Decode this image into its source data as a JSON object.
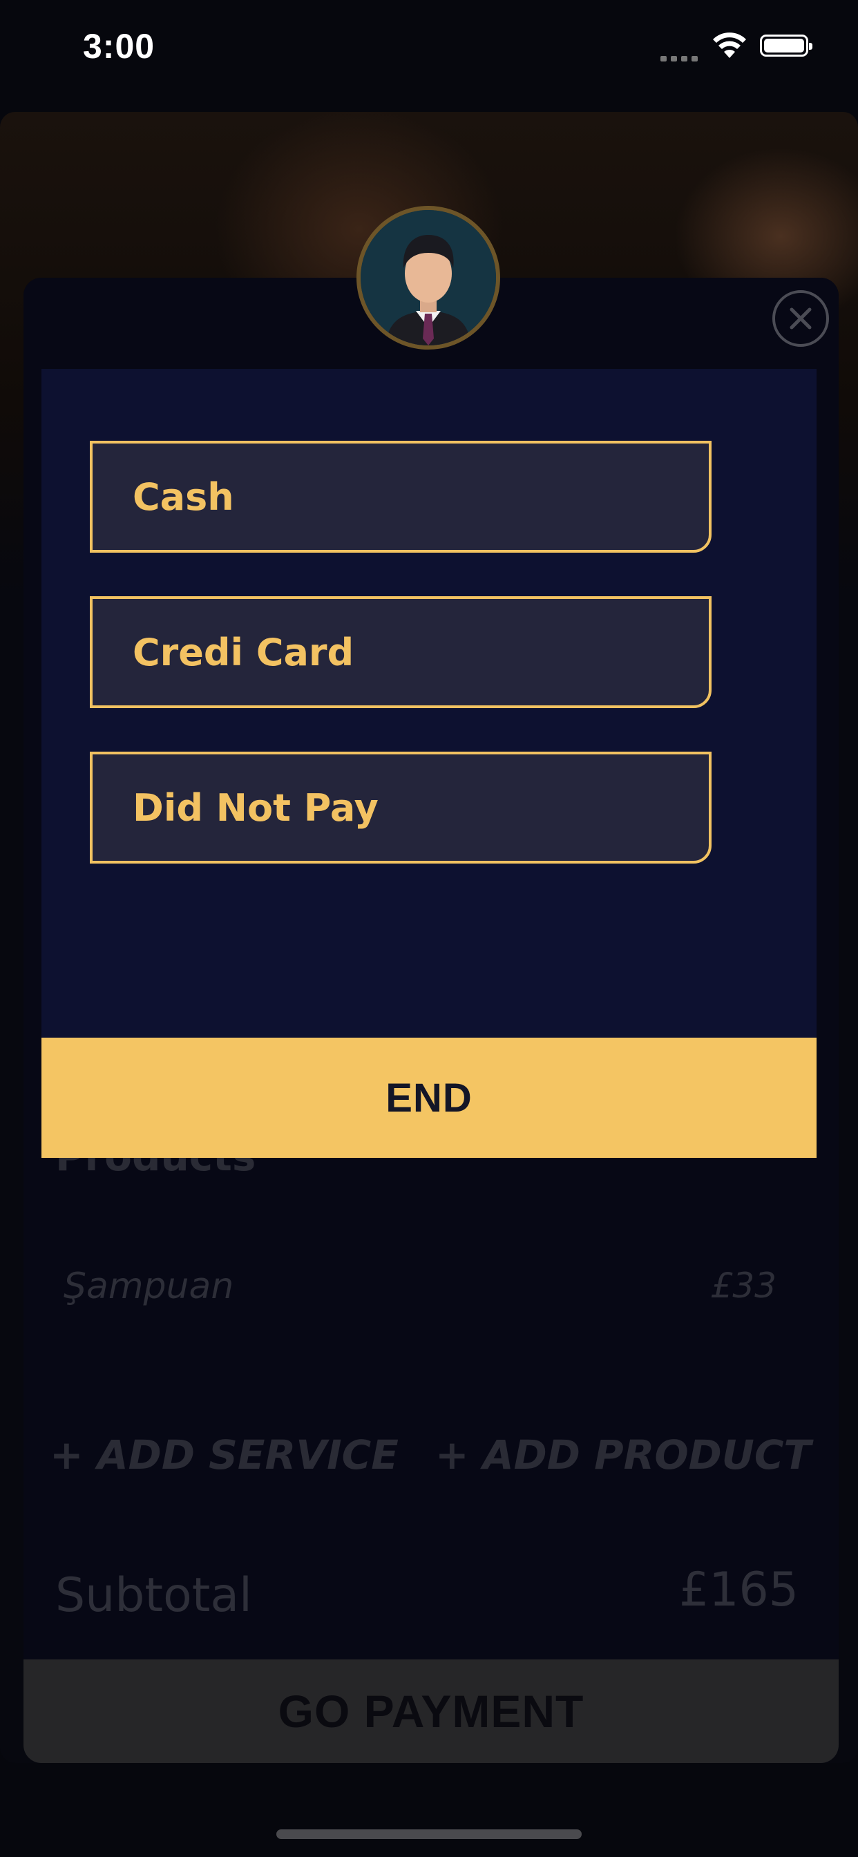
{
  "status_bar": {
    "time": "3:00"
  },
  "payment_modal": {
    "options": [
      "Cash",
      "Credi Card",
      "Did Not Pay"
    ],
    "end_label": "END"
  },
  "background": {
    "products_title": "Products",
    "product": {
      "name": "Şampuan",
      "price": "£33"
    },
    "add_service_label": "+ ADD SERVICE",
    "add_product_label": "+ ADD PRODUCT",
    "subtotal_label": "Subtotal",
    "subtotal_value": "£165",
    "go_payment_label": "GO PAYMENT"
  },
  "colors": {
    "accent": "#f4c563",
    "modal_panel": "#0d1130",
    "option_fill": "#24253b"
  }
}
